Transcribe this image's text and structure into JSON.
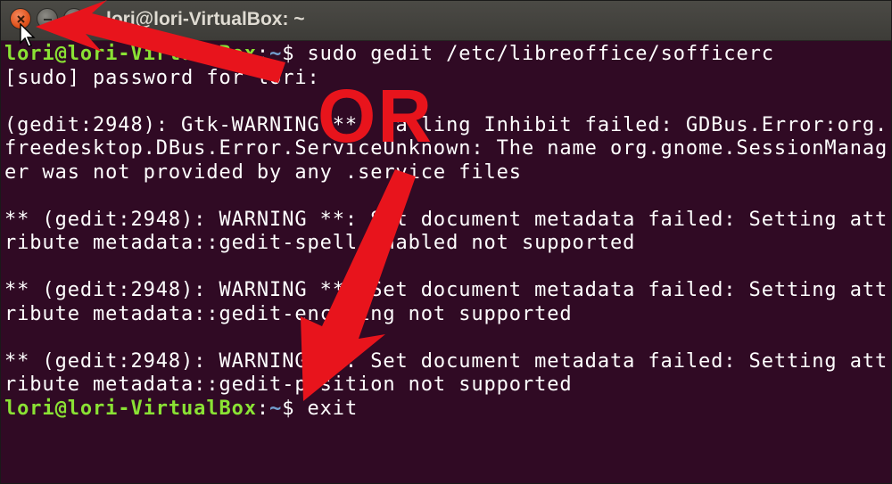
{
  "window": {
    "title": "lori@lori-VirtualBox: ~",
    "buttons": {
      "close": "close-icon",
      "minimize": "minimize-icon",
      "maximize": "maximize-icon"
    }
  },
  "terminal": {
    "lines": [
      {
        "prompt_user": "lori@lori-VirtualBox",
        "prompt_path": "~",
        "prompt_sym": "$ ",
        "text": "sudo gedit /etc/libreoffice/sofficerc"
      },
      {
        "text": "[sudo] password for lori:"
      },
      {
        "text": ""
      },
      {
        "text": "(gedit:2948): Gtk-WARNING **: Calling Inhibit failed: GDBus.Error:org."
      },
      {
        "text": "freedesktop.DBus.Error.ServiceUnknown: The name org.gnome.SessionManag"
      },
      {
        "text": "er was not provided by any .service files"
      },
      {
        "text": ""
      },
      {
        "text": "** (gedit:2948): WARNING **: Set document metadata failed: Setting att"
      },
      {
        "text": "ribute metadata::gedit-spell-enabled not supported"
      },
      {
        "text": ""
      },
      {
        "text": "** (gedit:2948): WARNING **: Set document metadata failed: Setting att"
      },
      {
        "text": "ribute metadata::gedit-encoding not supported"
      },
      {
        "text": ""
      },
      {
        "text": "** (gedit:2948): WARNING **: Set document metadata failed: Setting att"
      },
      {
        "text": "ribute metadata::gedit-position not supported"
      },
      {
        "prompt_user": "lori@lori-VirtualBox",
        "prompt_path": "~",
        "prompt_sym": "$ ",
        "text": "exit"
      }
    ]
  },
  "annotation": {
    "label": "OR",
    "color": "#e8141c"
  },
  "colors": {
    "terminal_bg": "#300a24",
    "prompt_user": "#8ae234",
    "prompt_path": "#729fcf",
    "text": "#ffffff"
  }
}
